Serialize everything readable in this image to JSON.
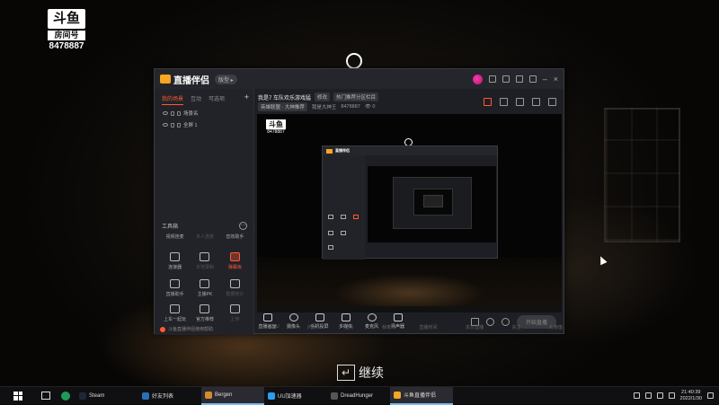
{
  "overlay": {
    "logo_text": "斗鱼",
    "room_label": "房间号",
    "room_id": "8478887",
    "continue_key": "↵",
    "continue_text": "继续"
  },
  "app": {
    "name": "直播伴侣",
    "version_badge": "版型 ▸",
    "sidebar": {
      "tabs": [
        "我的场景",
        "互动",
        "可选项"
      ],
      "add": "+",
      "sources": [
        "场景名",
        "全屏 1"
      ],
      "tools_title": "工具箱",
      "tools_more": "···",
      "tool_rows": [
        [
          {
            "label": "视频连麦",
            "dim": false
          },
          {
            "label": "多人连麦",
            "dim": true
          },
          {
            "label": "音效助手",
            "dim": false
          }
        ],
        [
          {
            "label": "连接器",
            "dim": false,
            "icon": "image-icon"
          },
          {
            "label": "本地录制",
            "dim": true,
            "icon": "download-icon"
          },
          {
            "label": "弹幕库",
            "dim": false,
            "red": true,
            "icon": "camera-icon"
          }
        ],
        [
          {
            "label": "直播助手",
            "dim": false,
            "icon": "grid-icon"
          },
          {
            "label": "主播PK",
            "dim": false,
            "icon": "pk-icon"
          },
          {
            "label": "数据统计",
            "dim": true,
            "icon": "download-icon"
          }
        ],
        [
          {
            "label": "上车一起玩",
            "dim": false,
            "icon": "car-icon"
          },
          {
            "label": "官方推荐",
            "dim": false,
            "icon": "scissors-icon"
          },
          {
            "label": "上传",
            "dim": true,
            "icon": "download-icon"
          }
        ]
      ],
      "footer": "斗鱼直播伴侣使用帮助"
    },
    "header": {
      "title": "我是7 车队欢乐游戏猛",
      "pill1": "修改",
      "pill2": "热门推荐分区栏目",
      "row2": [
        "英雄联盟 · 大神推荐",
        "我是大神王",
        "8478887",
        "👁 0"
      ]
    },
    "bottom_tools": [
      "直播画面",
      "摄像头",
      "手机投屏",
      "多媒体",
      "麦克风",
      "扬声器"
    ],
    "live_button": "开始直播",
    "status": [
      "CPU",
      "内存",
      "上行",
      "帧率",
      "直播时间",
      "本次直播",
      "关注",
      "礼物值"
    ]
  },
  "taskbar": {
    "items": [
      {
        "label": "Steam",
        "color": "#1b2838"
      },
      {
        "label": "好友列表",
        "color": "#2a6fb8"
      },
      {
        "label": "Bergen",
        "color": "#d88b2b",
        "active": true
      },
      {
        "label": "UU加速器",
        "color": "#2b9ef0"
      },
      {
        "label": "DreadHunger",
        "color": "#555555"
      },
      {
        "label": "斗鱼直播伴侣",
        "color": "#f6a623",
        "active": true
      }
    ],
    "time": "21:40:39",
    "date": "2022/1/30"
  }
}
